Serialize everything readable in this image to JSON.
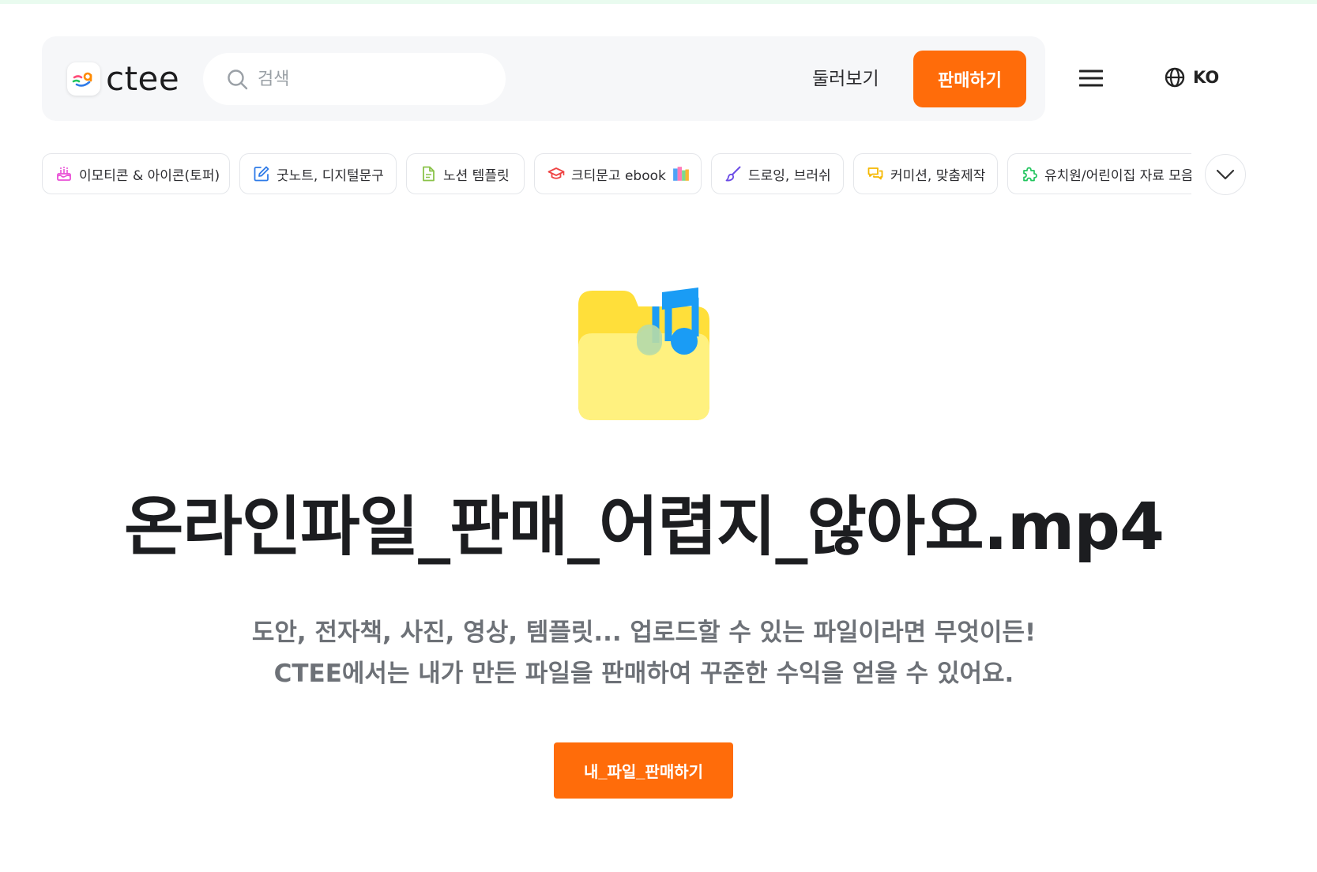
{
  "header": {
    "logo_text": "ctee",
    "search": {
      "placeholder": "검색",
      "value": ""
    },
    "browse_label": "둘러보기",
    "sell_label": "판매하기",
    "language": "KO"
  },
  "categories": [
    {
      "label": "이모티콘 & 아이콘(토퍼)",
      "icon": "cake-icon",
      "color": "#e94fd6"
    },
    {
      "label": "굿노트, 디지털문구",
      "icon": "edit-icon",
      "color": "#2f7be8"
    },
    {
      "label": "노션 템플릿",
      "icon": "document-icon",
      "color": "#8bc34a"
    },
    {
      "label": "크티문고 ebook",
      "icon": "graduation-cap-icon",
      "color": "#ef4444"
    },
    {
      "label": "드로잉, 브러쉬",
      "icon": "brush-icon",
      "color": "#6b4ce6"
    },
    {
      "label": "커미션, 맞춤제작",
      "icon": "chat-icon",
      "color": "#f5b800"
    },
    {
      "label": "유치원/어린이집 자료 모음",
      "icon": "puzzle-icon",
      "color": "#22c55e"
    }
  ],
  "hero": {
    "icon": "music-folder-icon",
    "title": "온라인파일_판매_어렵지_않아요.mp4",
    "description_line1": "도안, 전자책, 사진, 영상, 템플릿... 업로드할 수 있는 파일이라면 무엇이든!",
    "description_line2": "CTEE에서는 내가 만든 파일을 판매하여 꾸준한 수익을 얻을 수 있어요.",
    "cta_label": "내_파일_판매하기"
  },
  "colors": {
    "accent": "#ff6c0a",
    "header_bg": "#f6f7f9",
    "title": "#1c1d20",
    "description": "#6d7177"
  }
}
